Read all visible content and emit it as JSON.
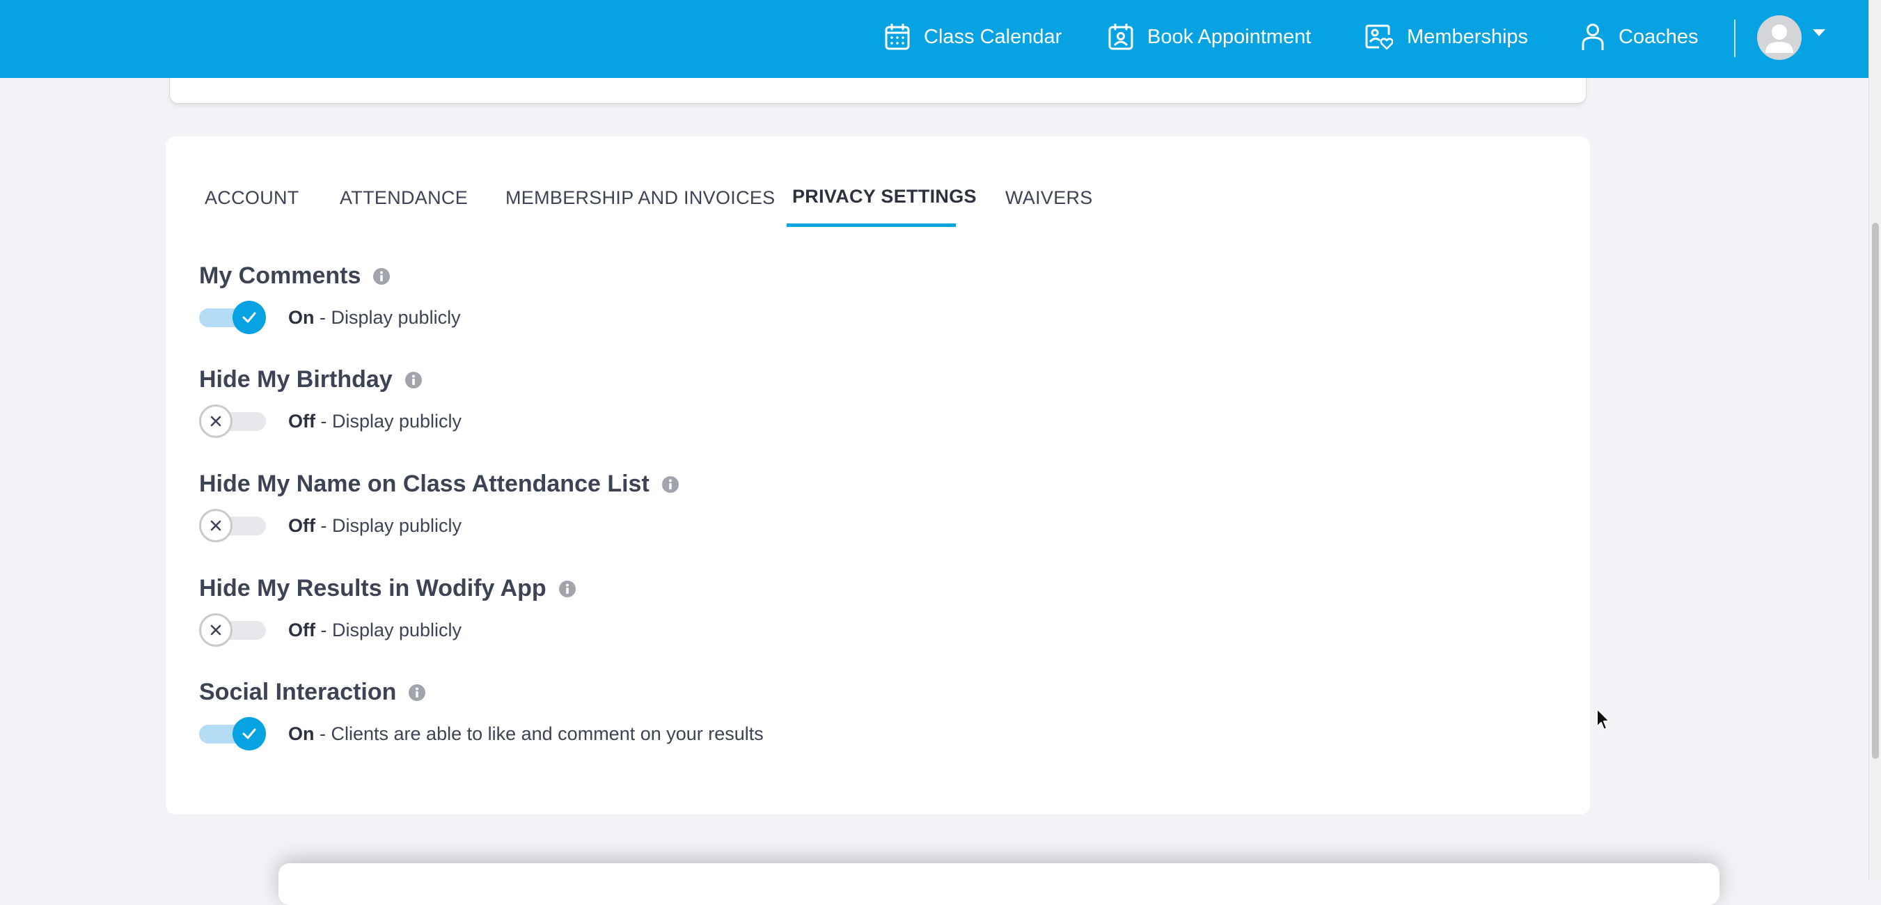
{
  "navbar": {
    "items": [
      {
        "label": "Class Calendar",
        "icon": "calendar-icon"
      },
      {
        "label": "Book Appointment",
        "icon": "appointment-icon"
      },
      {
        "label": "Memberships",
        "icon": "membership-icon"
      },
      {
        "label": "Coaches",
        "icon": "person-icon"
      }
    ],
    "avatar_icon": "user-avatar-icon",
    "menu_icon": "caret-down-icon"
  },
  "tabs": [
    {
      "label": "ACCOUNT",
      "active": false
    },
    {
      "label": "ATTENDANCE",
      "active": false
    },
    {
      "label": "MEMBERSHIP AND INVOICES",
      "active": false
    },
    {
      "label": "PRIVACY SETTINGS",
      "active": true
    },
    {
      "label": "WAIVERS",
      "active": false
    }
  ],
  "settings": [
    {
      "title": "My Comments",
      "enabled": true,
      "state": "On",
      "description": " - Display publicly"
    },
    {
      "title": "Hide My Birthday",
      "enabled": false,
      "state": "Off",
      "description": " - Display publicly"
    },
    {
      "title": "Hide My Name on Class Attendance List",
      "enabled": false,
      "state": "Off",
      "description": " - Display publicly"
    },
    {
      "title": "Hide My Results in Wodify App",
      "enabled": false,
      "state": "Off",
      "description": " - Display publicly"
    },
    {
      "title": "Social Interaction",
      "enabled": true,
      "state": "On",
      "description": " - Clients are able to like and comment on your results"
    }
  ],
  "colors": {
    "brand": "#06a2e2",
    "toggle_on_track": "#b5dcf5",
    "toggle_off_track": "#e7e8eb",
    "page_background": "#f2f3f7"
  }
}
